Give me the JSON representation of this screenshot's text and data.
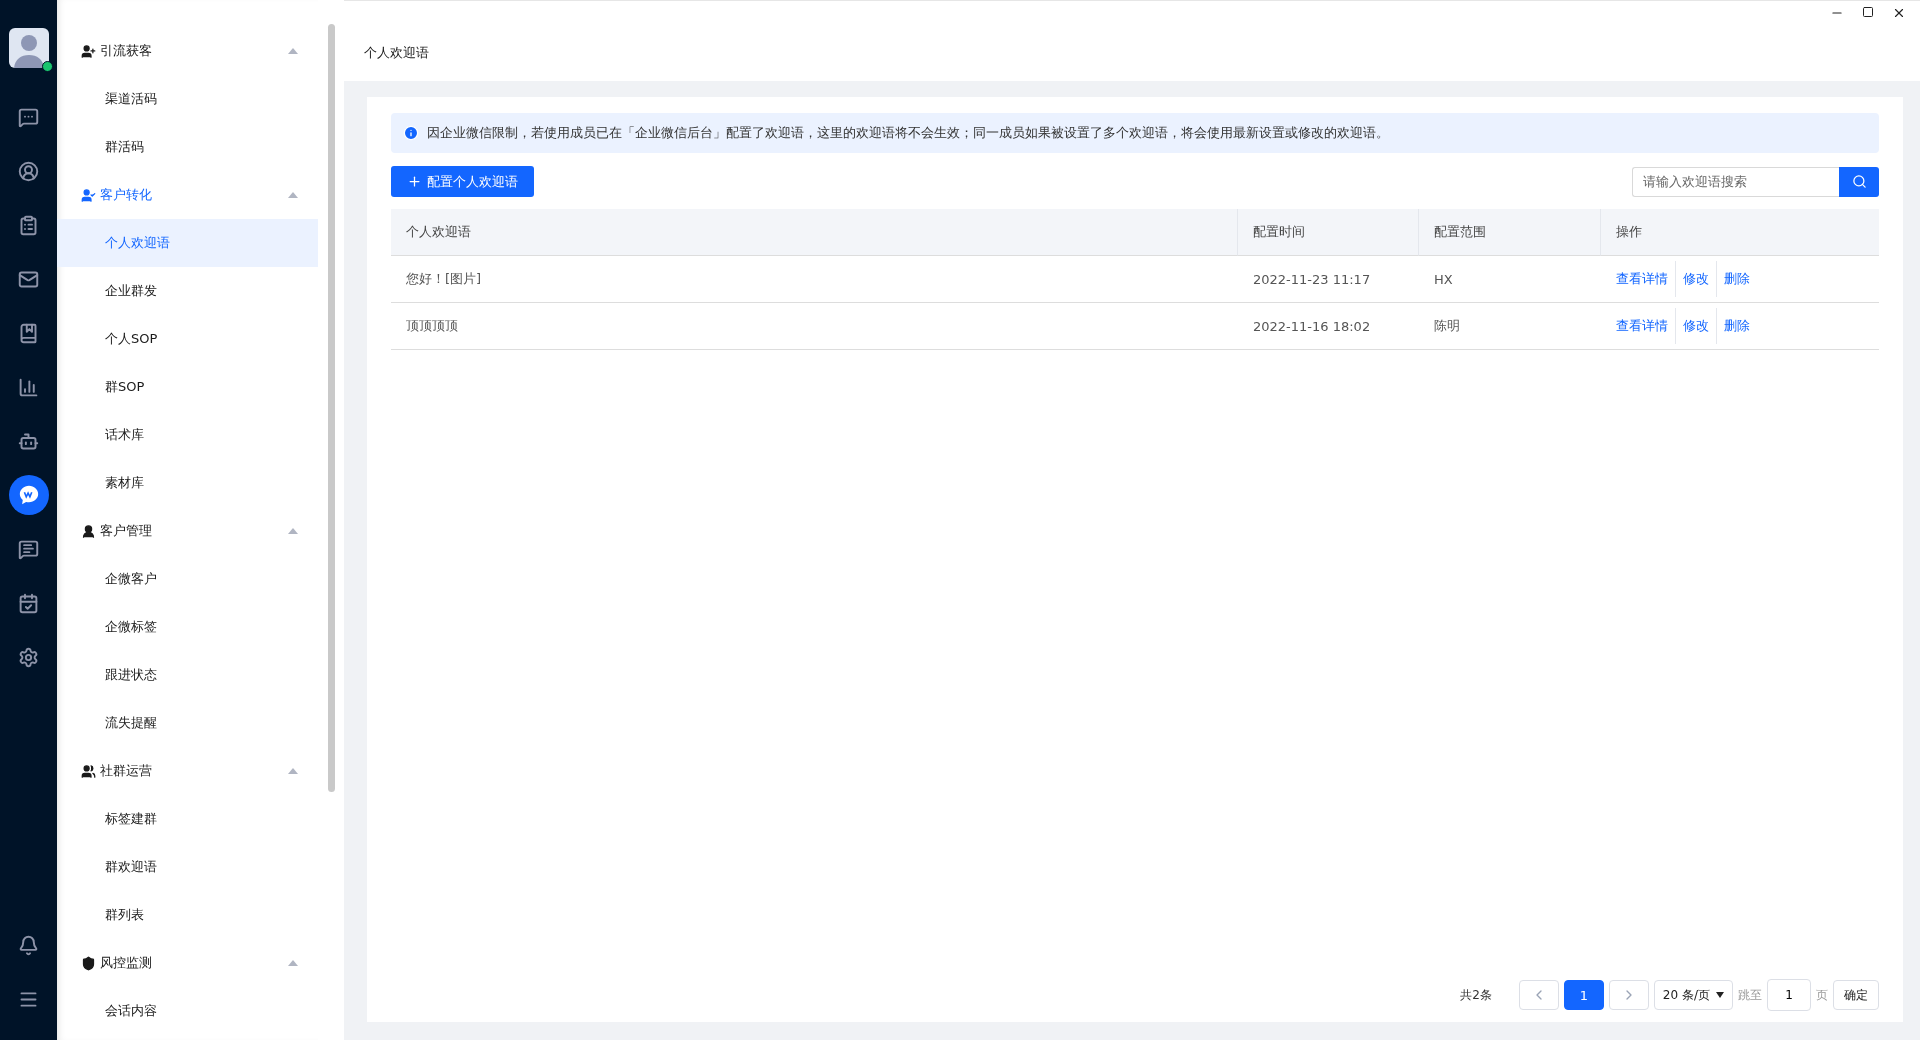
{
  "rail": {
    "avatar": {
      "online": true
    },
    "items": [
      {
        "kind": "chat",
        "selected": false
      },
      {
        "kind": "contact",
        "selected": false
      },
      {
        "kind": "task",
        "selected": false
      },
      {
        "kind": "mail",
        "selected": false
      },
      {
        "kind": "book",
        "selected": false
      },
      {
        "kind": "chart",
        "selected": false
      },
      {
        "kind": "robot",
        "selected": false
      },
      {
        "kind": "wecom",
        "selected": true
      },
      {
        "kind": "message",
        "selected": false
      },
      {
        "kind": "board",
        "selected": false
      },
      {
        "kind": "settings",
        "selected": false
      }
    ],
    "bottom": [
      {
        "kind": "bell",
        "selected": false
      },
      {
        "kind": "menu",
        "selected": false
      }
    ]
  },
  "sidebar": {
    "groups": [
      {
        "title": "引流获客",
        "kind": "user-plus",
        "expanded": true,
        "items": [
          {
            "label": "渠道活码",
            "selected": false
          },
          {
            "label": "群活码",
            "selected": false
          }
        ]
      },
      {
        "title": "客户转化",
        "kind": "user-share",
        "expanded": true,
        "items": [
          {
            "label": "个人欢迎语",
            "selected": true
          },
          {
            "label": "企业群发",
            "selected": false
          },
          {
            "label": "个人SOP",
            "selected": false
          },
          {
            "label": "群SOP",
            "selected": false
          },
          {
            "label": "话术库",
            "selected": false
          },
          {
            "label": "素材库",
            "selected": false
          }
        ]
      },
      {
        "title": "客户管理",
        "kind": "user",
        "expanded": true,
        "items": [
          {
            "label": "企微客户",
            "selected": false
          },
          {
            "label": "企微标签",
            "selected": false
          },
          {
            "label": "跟进状态",
            "selected": false
          },
          {
            "label": "流失提醒",
            "selected": false
          }
        ]
      },
      {
        "title": "社群运营",
        "kind": "users",
        "expanded": true,
        "items": [
          {
            "label": "标签建群",
            "selected": false
          },
          {
            "label": "群欢迎语",
            "selected": false
          },
          {
            "label": "群列表",
            "selected": false
          }
        ]
      },
      {
        "title": "风控监测",
        "kind": "shield",
        "expanded": true,
        "items": [
          {
            "label": "会话内容",
            "selected": false
          }
        ]
      }
    ]
  },
  "page_title": "个人欢迎语",
  "notice": "因企业微信限制，若使用成员已在「企业微信后台」配置了欢迎语，这里的欢迎语将不会生效；同一成员如果被设置了多个欢迎语，将会使用最新设置或修改的欢迎语。",
  "add_button": "配置个人欢迎语",
  "search": {
    "placeholder": "请输入欢迎语搜索"
  },
  "table": {
    "columns": [
      "个人欢迎语",
      "配置时间",
      "配置范围",
      "操作"
    ],
    "rows": [
      {
        "cells": [
          "您好！[图片]",
          "2022-11-23 11:17",
          "HX"
        ],
        "actions": [
          "查看详情",
          "修改",
          "删除"
        ]
      },
      {
        "cells": [
          "顶顶顶顶",
          "2022-11-16 18:02",
          "陈明"
        ],
        "actions": [
          "查看详情",
          "修改",
          "删除"
        ]
      }
    ]
  },
  "pagination": {
    "total": "共2条",
    "pages": [
      {
        "label": "1",
        "selected": true
      }
    ],
    "page_size": "20 条/页",
    "jump_label": "跳至",
    "jump_value": "1",
    "page_unit": "页",
    "confirm": "确定"
  }
}
